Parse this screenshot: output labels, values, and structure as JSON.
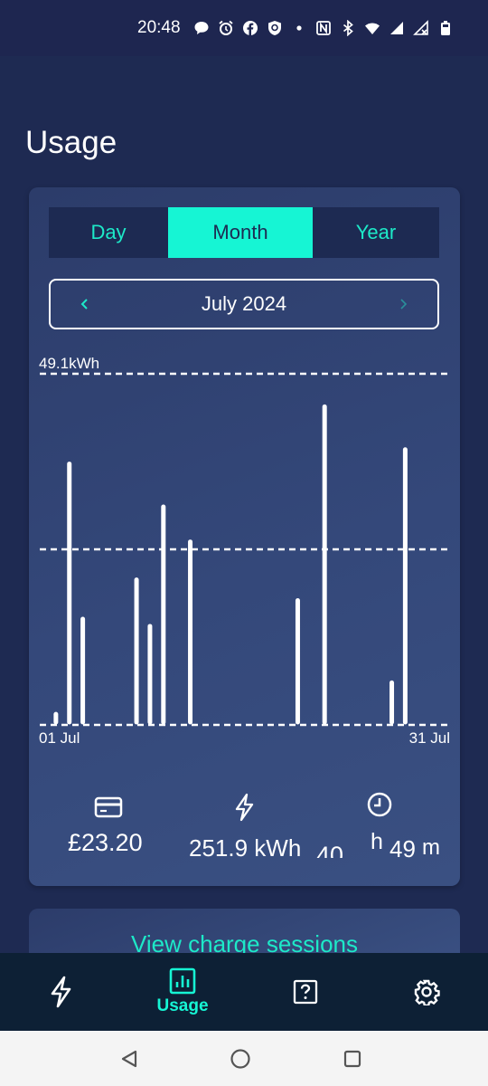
{
  "status_bar": {
    "time": "20:48",
    "icons": [
      "chat-bubble-icon",
      "alarm-icon",
      "facebook-icon",
      "shield-icon",
      "dot-icon",
      "nfc-icon",
      "bluetooth-icon",
      "wifi-icon",
      "signal-icon",
      "signal-no-data-icon",
      "battery-icon"
    ]
  },
  "page": {
    "title": "Usage"
  },
  "tabs": [
    {
      "label": "Day",
      "active": false
    },
    {
      "label": "Month",
      "active": true
    },
    {
      "label": "Year",
      "active": false
    }
  ],
  "period": {
    "label": "July 2024",
    "prev_icon": "chevron-left-icon",
    "next_icon": "chevron-right-icon"
  },
  "chart_data": {
    "type": "bar",
    "max_label": "49.1kWh",
    "ylim": [
      0,
      49.1
    ],
    "x_start_label": "01 Jul",
    "x_end_label": "31 Jul",
    "days": [
      2,
      3,
      4,
      8,
      9,
      10,
      12,
      20,
      22,
      27,
      28
    ],
    "values": [
      1.5,
      36.5,
      14.8,
      20.3,
      13.8,
      30.5,
      25.6,
      17.4,
      44.5,
      5.9,
      38.5
    ]
  },
  "stats": {
    "cost": {
      "icon": "card-icon",
      "value": "£23.20"
    },
    "energy": {
      "icon": "lightning-icon",
      "value": "251.9 kWh"
    },
    "duration": {
      "icon": "clock-icon",
      "hours": "40",
      "h_unit": "h",
      "minutes": "49",
      "m_unit": "m"
    }
  },
  "sessions_link": {
    "label": "View charge sessions"
  },
  "bottom_nav": [
    {
      "icon": "lightning-icon",
      "label": ""
    },
    {
      "icon": "bar-chart-icon",
      "label": "Usage",
      "active": true
    },
    {
      "icon": "help-icon",
      "label": ""
    },
    {
      "icon": "gear-icon",
      "label": ""
    }
  ],
  "colors": {
    "accent": "#16f5d4",
    "background": "#1e2a52",
    "card": "#34487a",
    "nav": "#0d2035"
  }
}
